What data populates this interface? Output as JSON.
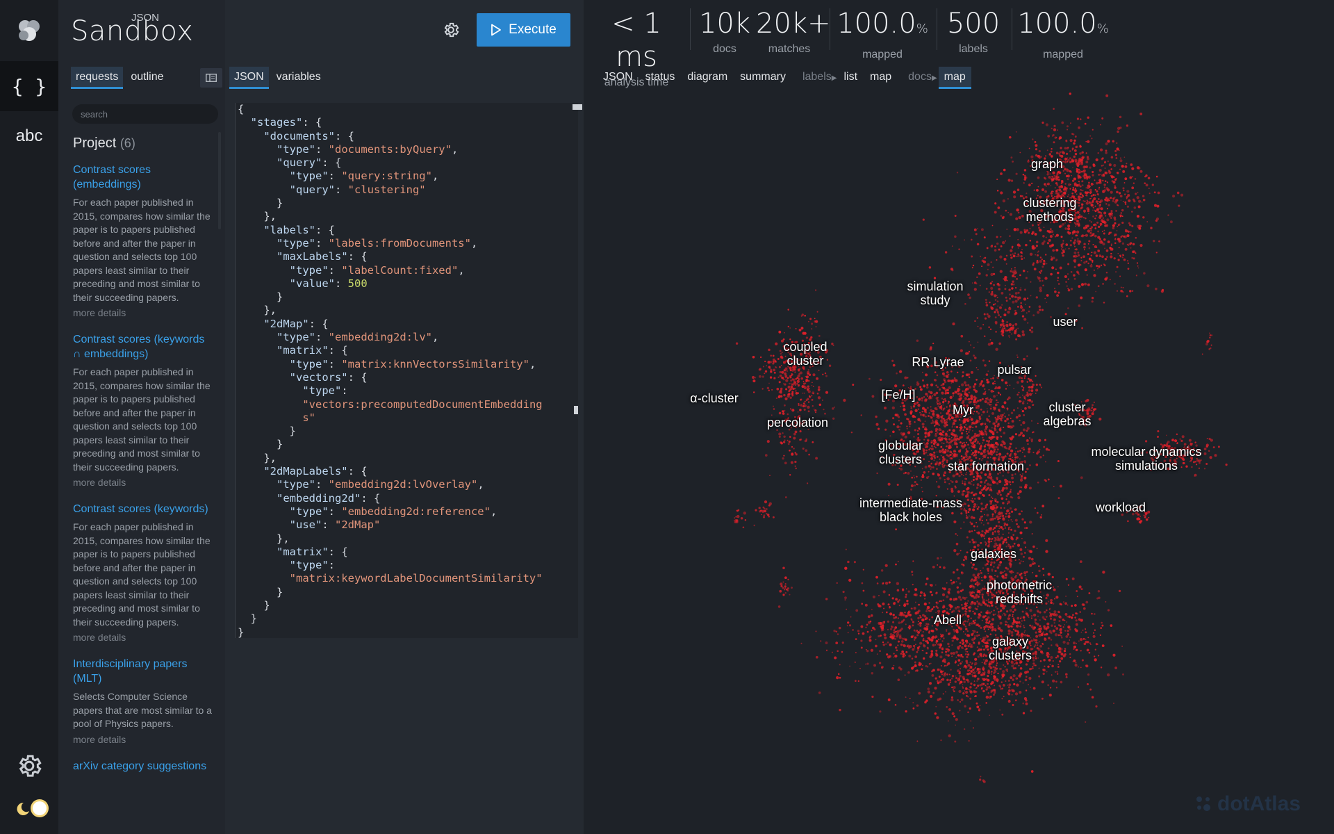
{
  "app": {
    "title": "Sandbox",
    "super": "JSON"
  },
  "rail": {
    "json_label": "{ }",
    "abc_label": "abc"
  },
  "left": {
    "tabs": [
      {
        "label": "requests",
        "active": true
      },
      {
        "label": "outline",
        "active": false
      }
    ],
    "search_placeholder": "search",
    "project_label": "Project",
    "project_count": "(6)",
    "requests": [
      {
        "title": "Contrast scores (embeddings)",
        "desc": "For each paper published in 2015, compares how similar the paper is to papers published before and after the paper in question and selects top 100 papers least similar to their preceding and most similar to their succeeding papers.",
        "more": "more details"
      },
      {
        "title": "Contrast scores (keywords ∩ embeddings)",
        "desc": "For each paper published in 2015, compares how similar the paper is to papers published before and after the paper in question and selects top 100 papers least similar to their preceding and most similar to their succeeding papers.",
        "more": "more details"
      },
      {
        "title": "Contrast scores (keywords)",
        "desc": "For each paper published in 2015, compares how similar the paper is to papers published before and after the paper in question and selects top 100 papers least similar to their preceding and most similar to their succeeding papers.",
        "more": "more details"
      },
      {
        "title": "Interdisciplinary papers (MLT)",
        "desc": "Selects Computer Science papers that are most similar to a pool of Physics papers.",
        "more": "more details"
      },
      {
        "title": "arXiv category suggestions",
        "desc": "",
        "more": ""
      }
    ]
  },
  "editor": {
    "execute_label": "Execute",
    "tabs": [
      {
        "label": "JSON",
        "active": true
      },
      {
        "label": "variables",
        "active": false
      }
    ]
  },
  "stats": [
    {
      "value": "< 1",
      "unit": " ms",
      "label": "analysis time"
    },
    {
      "value": "10k",
      "unit": "",
      "label": "docs"
    },
    {
      "value": "20k+",
      "unit": "",
      "label": "matches"
    },
    {
      "value": "100.0",
      "unit": "%",
      "label": "mapped"
    },
    {
      "value": "500",
      "unit": "",
      "label": "labels"
    },
    {
      "value": "100.0",
      "unit": "%",
      "label": "mapped"
    }
  ],
  "right_tabs": {
    "main": [
      {
        "label": "JSON"
      },
      {
        "label": "status"
      },
      {
        "label": "diagram"
      },
      {
        "label": "summary"
      }
    ],
    "labels_group": "labels",
    "labels_tabs": [
      {
        "label": "list"
      },
      {
        "label": "map"
      }
    ],
    "docs_group": "docs",
    "docs_tabs": [
      {
        "label": "map",
        "active": true
      }
    ]
  },
  "map": {
    "point_color": "#e3202a",
    "labels": [
      {
        "text": "graph"
      },
      {
        "text": "clustering\nmethods"
      },
      {
        "text": "simulation\nstudy"
      },
      {
        "text": "user"
      },
      {
        "text": "coupled\ncluster"
      },
      {
        "text": "α-cluster"
      },
      {
        "text": "percolation"
      },
      {
        "text": "RR Lyrae"
      },
      {
        "text": "pulsar"
      },
      {
        "text": "[Fe/H]"
      },
      {
        "text": "Myr"
      },
      {
        "text": "cluster\nalgebras"
      },
      {
        "text": "globular\nclusters"
      },
      {
        "text": "star formation"
      },
      {
        "text": "molecular dynamics\nsimulations"
      },
      {
        "text": "intermediate-mass\nblack holes"
      },
      {
        "text": "workload"
      },
      {
        "text": "galaxies"
      },
      {
        "text": "photometric\nredshifts"
      },
      {
        "text": "Abell"
      },
      {
        "text": "galaxy\nclusters"
      }
    ],
    "watermark": "dotAtlas"
  }
}
